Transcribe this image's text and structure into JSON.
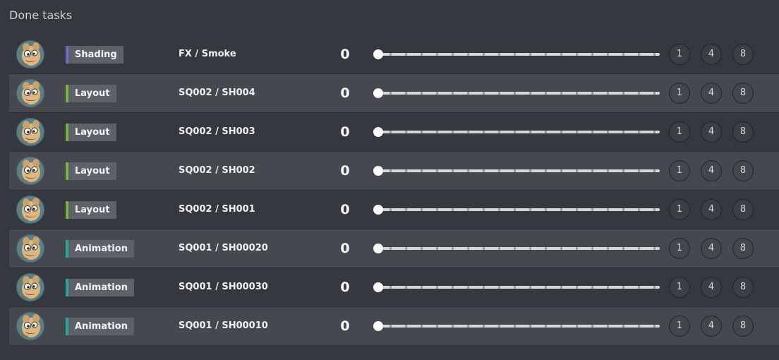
{
  "page": {
    "title": "Done tasks"
  },
  "quick_values": [
    "1",
    "4",
    "8"
  ],
  "rows": [
    {
      "task_type": "Shading",
      "type_color": "#6a6fc7",
      "entity": "FX / Smoke",
      "count": "0",
      "progress": 0
    },
    {
      "task_type": "Layout",
      "type_color": "#7cb342",
      "entity": "SQ002 / SH004",
      "count": "0",
      "progress": 0
    },
    {
      "task_type": "Layout",
      "type_color": "#7cb342",
      "entity": "SQ002 / SH003",
      "count": "0",
      "progress": 0
    },
    {
      "task_type": "Layout",
      "type_color": "#7cb342",
      "entity": "SQ002 / SH002",
      "count": "0",
      "progress": 0
    },
    {
      "task_type": "Layout",
      "type_color": "#7cb342",
      "entity": "SQ002 / SH001",
      "count": "0",
      "progress": 0
    },
    {
      "task_type": "Animation",
      "type_color": "#26a69a",
      "entity": "SQ001 / SH00020",
      "count": "0",
      "progress": 0
    },
    {
      "task_type": "Animation",
      "type_color": "#26a69a",
      "entity": "SQ001 / SH00030",
      "count": "0",
      "progress": 0
    },
    {
      "task_type": "Animation",
      "type_color": "#26a69a",
      "entity": "SQ001 / SH00010",
      "count": "0",
      "progress": 0
    }
  ]
}
